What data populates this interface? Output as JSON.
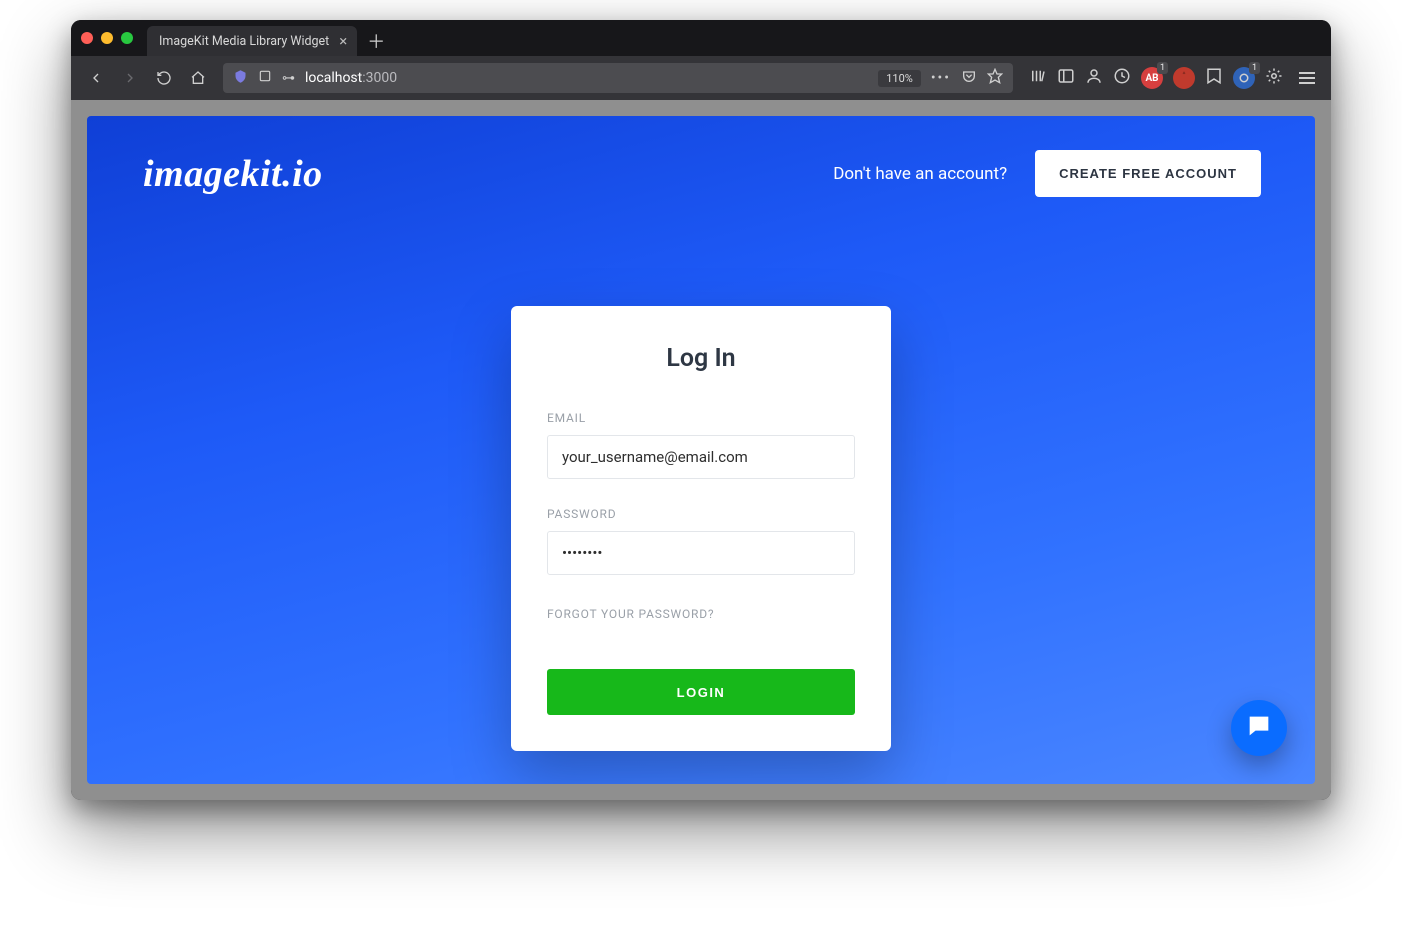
{
  "browser": {
    "tab_title": "ImageKit Media Library Widget",
    "url_main": "localhost",
    "url_rest": ":3000",
    "zoom": "110%",
    "ext_badge_1": "1",
    "ext_badge_2": "1"
  },
  "header": {
    "logo": "imagekit.io",
    "no_account": "Don't have an account?",
    "create_button": "CREATE FREE ACCOUNT"
  },
  "card": {
    "title": "Log In",
    "email_label": "EMAIL",
    "email_value": "your_username@email.com",
    "password_label": "PASSWORD",
    "password_value": "••••••••",
    "forgot": "FORGOT YOUR PASSWORD?",
    "login_button": "LOGIN"
  },
  "colors": {
    "brand_gradient_start": "#0f3fd6",
    "brand_gradient_end": "#4a86ff",
    "accent_green": "#17b81a",
    "chat_blue": "#0a6cff"
  }
}
